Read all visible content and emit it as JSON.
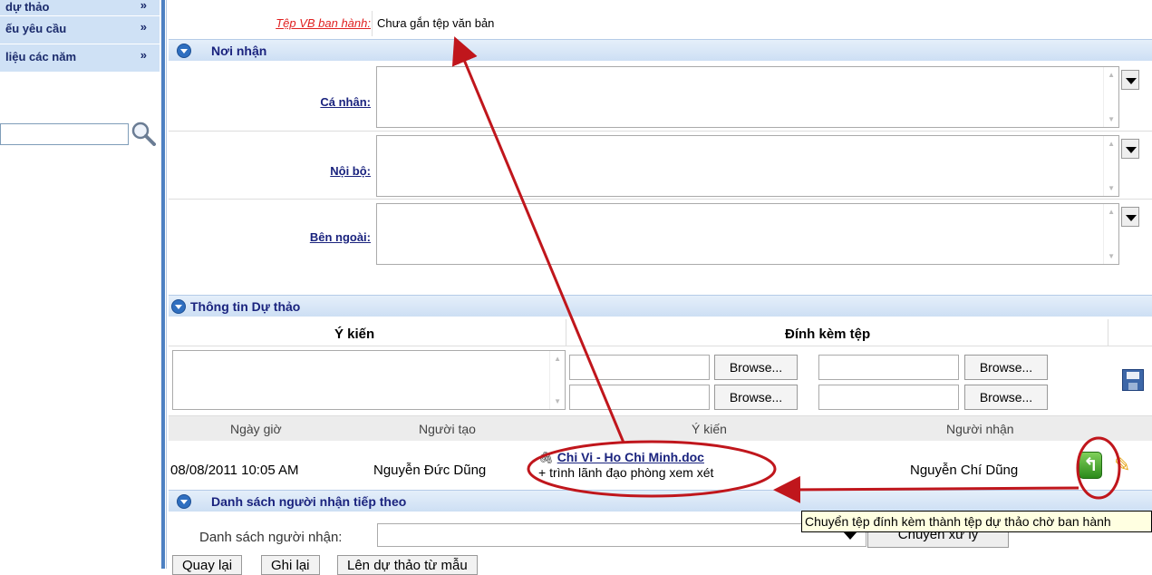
{
  "sidebar": {
    "items": [
      {
        "label": "dự thảo",
        "chevron": "»"
      },
      {
        "label": "ếu yêu cầu",
        "chevron": "»"
      },
      {
        "label": "liệu các năm",
        "chevron": "»"
      }
    ],
    "search_placeholder": ""
  },
  "file_row": {
    "label": "Tệp VB ban hành:",
    "value": "Chưa gắn tệp văn bản"
  },
  "noi_nhan": {
    "title": "Nơi nhận",
    "rows": [
      {
        "label": "Cá nhân:"
      },
      {
        "label": "Nội bộ:"
      },
      {
        "label": "Bên ngoài:"
      }
    ]
  },
  "thong_tin": {
    "title": "Thông tin Dự thảo",
    "col_ykien": "Ý kiến",
    "col_dinhkem": "Đính kèm tệp",
    "browse_label": "Browse..."
  },
  "history": {
    "headers": [
      "Ngày giờ",
      "Người tạo",
      "Ý kiến",
      "Người nhận"
    ],
    "row": {
      "date": "08/08/2011 10:05 AM",
      "creator": "Nguyễn Đức Dũng",
      "attachment": "Chi Vi - Ho Chi Minh.doc",
      "comment": "+ trình lãnh đạo phòng xem xét",
      "receiver": "Nguyễn Chí Dũng"
    }
  },
  "next_recipients": {
    "title": "Danh sách người nhận tiếp theo",
    "label": "Danh sách người nhận:",
    "button": "Chuyển xử lý",
    "tooltip": "Chuyển tệp đính kèm thành tệp dự thảo chờ ban hành"
  },
  "bottom_buttons": [
    "Quay lại",
    "Ghi lại",
    "Lên dự thảo từ mẫu"
  ],
  "colors": {
    "accent": "#2f6fc0",
    "annotation": "#c0161c",
    "link_red": "#e02020"
  }
}
